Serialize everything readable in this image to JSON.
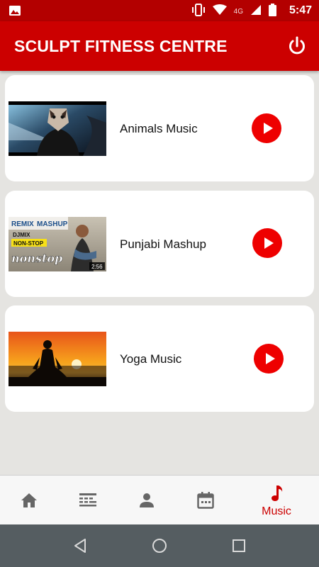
{
  "status_bar": {
    "time": "5:47",
    "network": "4G",
    "icons": [
      "image-notification-icon",
      "vibrate-icon",
      "wifi-icon",
      "cell-signal-icon",
      "battery-icon"
    ]
  },
  "app_bar": {
    "title": "SCULPT FITNESS CENTRE",
    "power_icon": "power-icon"
  },
  "tracks": [
    {
      "title": "Animals Music",
      "thumbnail": "masked-performer-thumbnail"
    },
    {
      "title": "Punjabi Mashup",
      "thumbnail": "remix-mashup-thumbnail",
      "thumb_text": [
        "REMIX",
        "MASHUP",
        "DJMIX",
        "NON-STOP",
        "nonstop",
        "2:56"
      ]
    },
    {
      "title": "Yoga Music",
      "thumbnail": "yoga-sunset-thumbnail"
    }
  ],
  "bottom_nav": {
    "items": [
      {
        "icon": "home-icon"
      },
      {
        "icon": "schedule-icon"
      },
      {
        "icon": "person-icon"
      },
      {
        "icon": "calendar-icon"
      },
      {
        "icon": "music-note-icon",
        "label": "Music",
        "active": true
      }
    ]
  },
  "colors": {
    "status_bar": "#b30000",
    "app_bar": "#cc0000",
    "play_button": "#ee0000",
    "background": "#e5e4e1",
    "system_nav": "#555d61"
  }
}
